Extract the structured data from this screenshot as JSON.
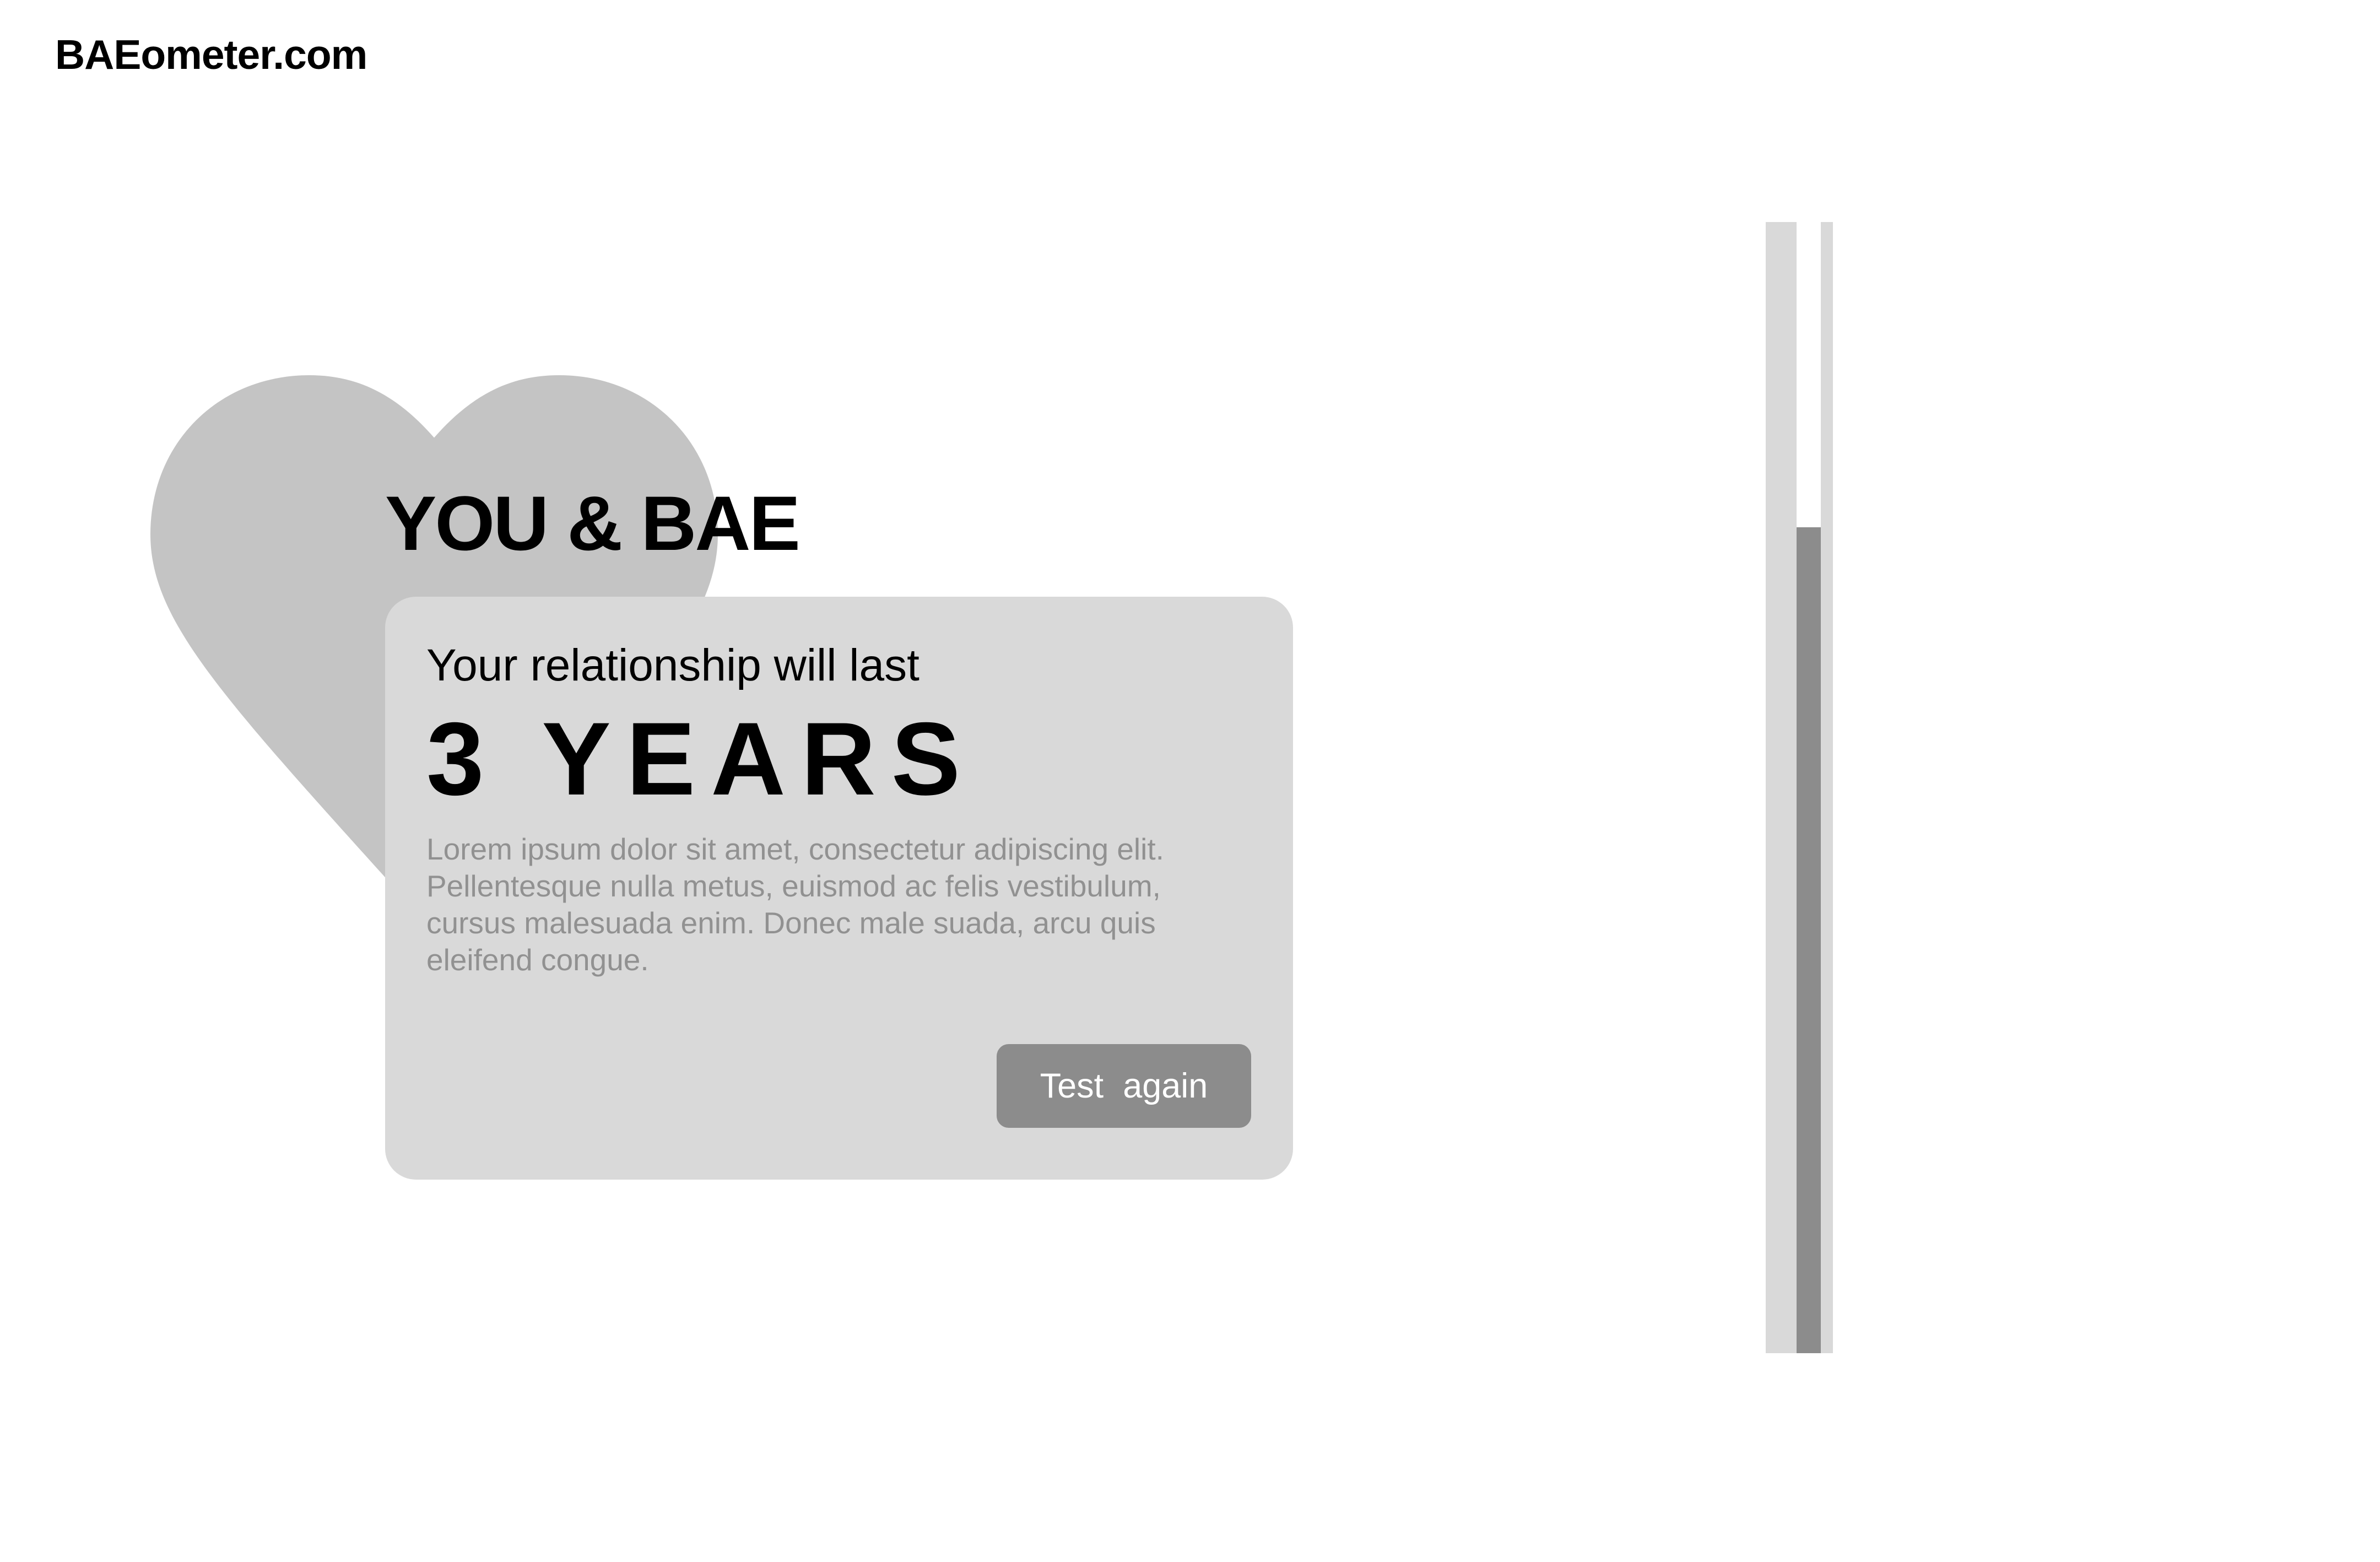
{
  "site": {
    "logo_text": "BAEometer.com"
  },
  "hero": {
    "headline": "YOU & BAE",
    "heart_color": "#c4c4c4"
  },
  "result_card": {
    "subtitle": "Your relationship will last",
    "result": "3 YEARS",
    "body": "Lorem ipsum dolor sit amet, consectetur adipiscing elit. Pellentesque nulla metus, euismod ac felis vestibulum, cursus malesuada enim. Donec male suada, arcu quis eleifend congue.",
    "button_label": "Test  again"
  },
  "meter": {
    "fill_fraction": 0.73,
    "fill_color": "#8c8c8c",
    "frame_color": "#d9d9d9"
  }
}
